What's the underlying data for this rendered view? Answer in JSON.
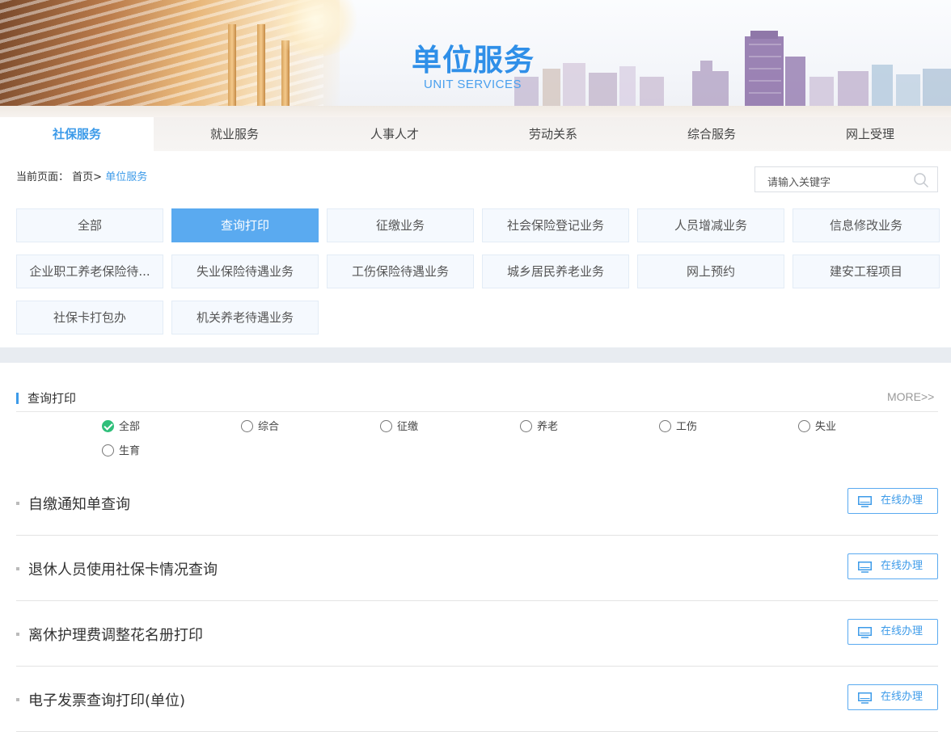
{
  "banner": {
    "title": "单位服务",
    "subtitle": "UNIT SERVICES"
  },
  "nav": {
    "items": [
      {
        "label": "社保服务",
        "active": true
      },
      {
        "label": "就业服务",
        "active": false
      },
      {
        "label": "人事人才",
        "active": false
      },
      {
        "label": "劳动关系",
        "active": false
      },
      {
        "label": "综合服务",
        "active": false
      },
      {
        "label": "网上受理",
        "active": false
      }
    ]
  },
  "breadcrumb": {
    "prefix": "当前页面：",
    "home": "首页>",
    "current": "单位服务"
  },
  "search": {
    "placeholder": "请输入关键字",
    "icon": "search-icon"
  },
  "categories": [
    {
      "label": "全部",
      "active": false
    },
    {
      "label": "查询打印",
      "active": true
    },
    {
      "label": "征缴业务",
      "active": false
    },
    {
      "label": "社会保险登记业务",
      "active": false
    },
    {
      "label": "人员增减业务",
      "active": false
    },
    {
      "label": "信息修改业务",
      "active": false
    },
    {
      "label": "企业职工养老保险待...",
      "active": false
    },
    {
      "label": "失业保险待遇业务",
      "active": false
    },
    {
      "label": "工伤保险待遇业务",
      "active": false
    },
    {
      "label": "城乡居民养老业务",
      "active": false
    },
    {
      "label": "网上预约",
      "active": false
    },
    {
      "label": "建安工程项目",
      "active": false
    },
    {
      "label": "社保卡打包办",
      "active": false
    },
    {
      "label": "机关养老待遇业务",
      "active": false
    }
  ],
  "section": {
    "title": "查询打印",
    "more": "MORE>>",
    "filters": [
      {
        "label": "全部",
        "checked": true
      },
      {
        "label": "综合",
        "checked": false
      },
      {
        "label": "征缴",
        "checked": false
      },
      {
        "label": "养老",
        "checked": false
      },
      {
        "label": "工伤",
        "checked": false
      },
      {
        "label": "失业",
        "checked": false
      },
      {
        "label": "生育",
        "checked": false
      }
    ],
    "items": [
      {
        "title": "自缴通知单查询",
        "action": "在线办理"
      },
      {
        "title": "退休人员使用社保卡情况查询",
        "action": "在线办理"
      },
      {
        "title": "离休护理费调整花名册打印",
        "action": "在线办理"
      },
      {
        "title": "电子发票查询打印(单位)",
        "action": "在线办理"
      }
    ]
  },
  "colors": {
    "accent": "#3d9be9",
    "active_category": "#5aaaf0",
    "checked_radio": "#2fbf7a"
  }
}
